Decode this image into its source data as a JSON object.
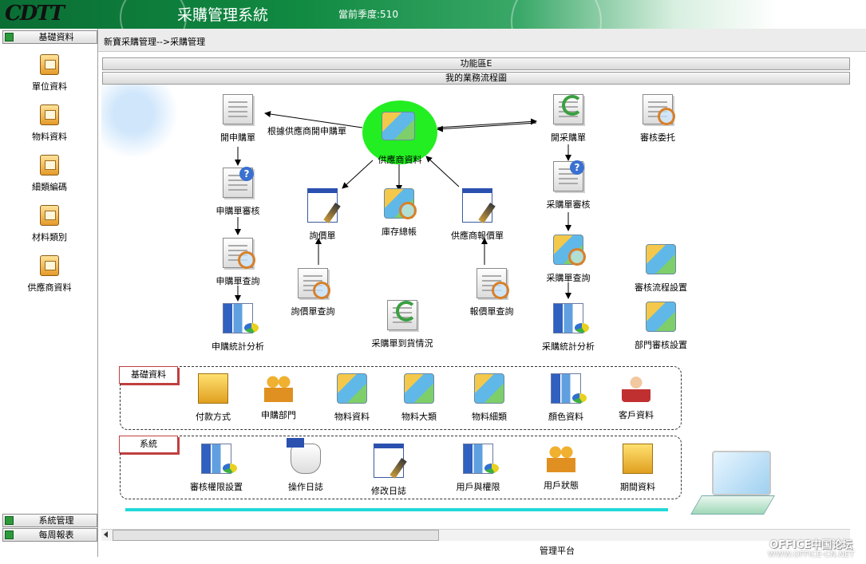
{
  "header": {
    "logo": "CDTT",
    "title": "采購管理系統",
    "season": "當前季度:510"
  },
  "sidebar": {
    "section_top": "基礎資料",
    "items": [
      {
        "label": "單位資料",
        "icon": "card-file-icon"
      },
      {
        "label": "物料資料",
        "icon": "card-file-icon"
      },
      {
        "label": "細類編碼",
        "icon": "card-file-icon"
      },
      {
        "label": "材料類別",
        "icon": "card-file-icon"
      },
      {
        "label": "供應商資料",
        "icon": "card-file-icon"
      }
    ],
    "section_bottom_1": "系統管理",
    "section_bottom_2": "每周報表"
  },
  "breadcrumb": "新寶采購管理-->采購管理",
  "strips": {
    "function_area": "功能區E",
    "flow_title": "我的業務流程圖"
  },
  "flow": {
    "hub_label": "供應商資料",
    "hub_caption": "根據供應商開申購單",
    "left_col": [
      "開申購單",
      "申購單審核",
      "申購單查詢",
      "申購統計分析"
    ],
    "mid": [
      "詢價單",
      "庫存總帳",
      "供應商報價單",
      "詢價單查詢",
      "采購單到貨情況",
      "報價單查詢"
    ],
    "right_col": [
      "開采購單",
      "采購單審核",
      "采購單查詢",
      "采購統計分析"
    ],
    "far_right": [
      "審核委托",
      "審核流程設置",
      "部門審核設置"
    ]
  },
  "basic_box": {
    "title": "基礎資料",
    "items": [
      "付款方式",
      "申購部門",
      "物料資料",
      "物料大類",
      "物料細類",
      "顏色資料",
      "客戶資料"
    ]
  },
  "system_box": {
    "title": "系統",
    "items": [
      "審核權限設置",
      "操作日誌",
      "修改日誌",
      "用戶與權限",
      "用戶狀態",
      "期間資料"
    ]
  },
  "status": {
    "text": "管理平台"
  },
  "watermark": {
    "line1": "OFFICE中国论坛",
    "line2": "WWW.OFFICE-CN.NET"
  },
  "colors": {
    "header": "#118a42",
    "hub": "#22ee22",
    "accent_line": "#22d8d8",
    "box_label_border": "#c04040"
  }
}
